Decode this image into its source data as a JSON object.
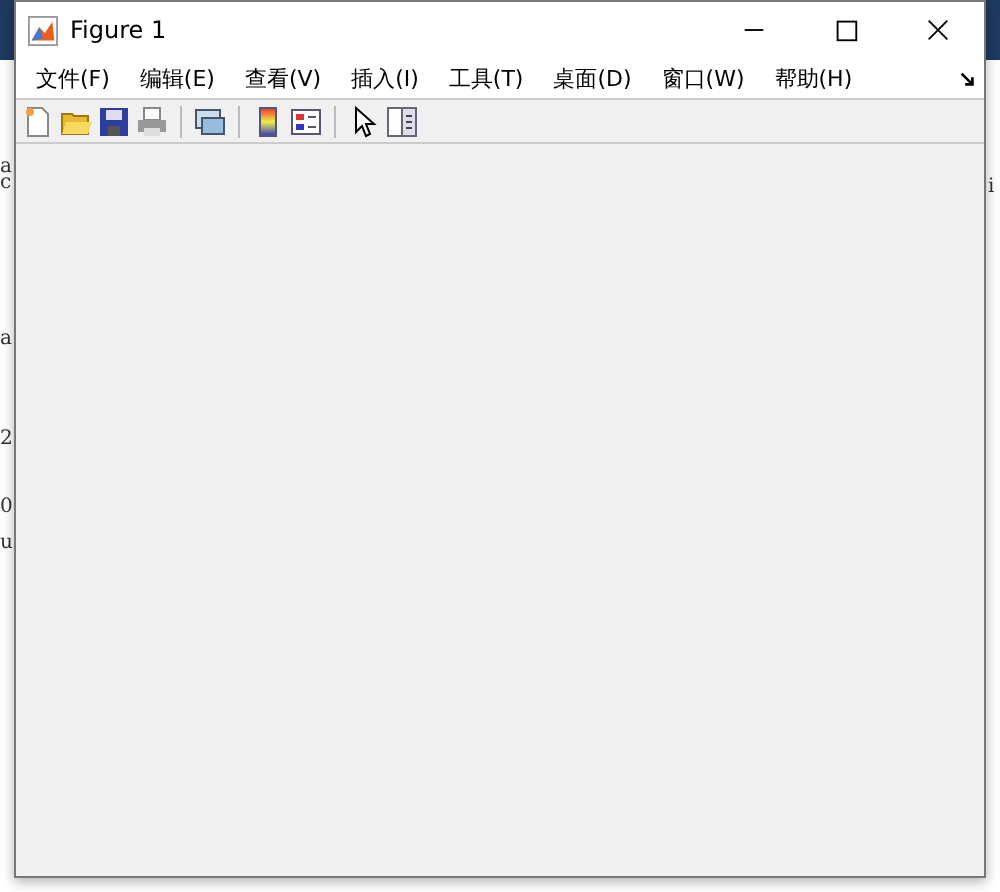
{
  "background": {
    "left_fragments": [
      "a",
      "c",
      "a",
      "2",
      "0",
      "u"
    ],
    "right_fragments": [
      "i"
    ]
  },
  "window": {
    "title": "Figure 1"
  },
  "menu": [
    "文件(F)",
    "编辑(E)",
    "查看(V)",
    "插入(I)",
    "工具(T)",
    "桌面(D)",
    "窗口(W)",
    "帮助(H)"
  ],
  "toolbar": [
    {
      "kind": "new"
    },
    {
      "kind": "open"
    },
    {
      "kind": "save"
    },
    {
      "kind": "print"
    },
    {
      "kind": "sep"
    },
    {
      "kind": "link"
    },
    {
      "kind": "sep"
    },
    {
      "kind": "colorbar"
    },
    {
      "kind": "legend"
    },
    {
      "kind": "sep"
    },
    {
      "kind": "pointer"
    },
    {
      "kind": "panel"
    }
  ]
}
